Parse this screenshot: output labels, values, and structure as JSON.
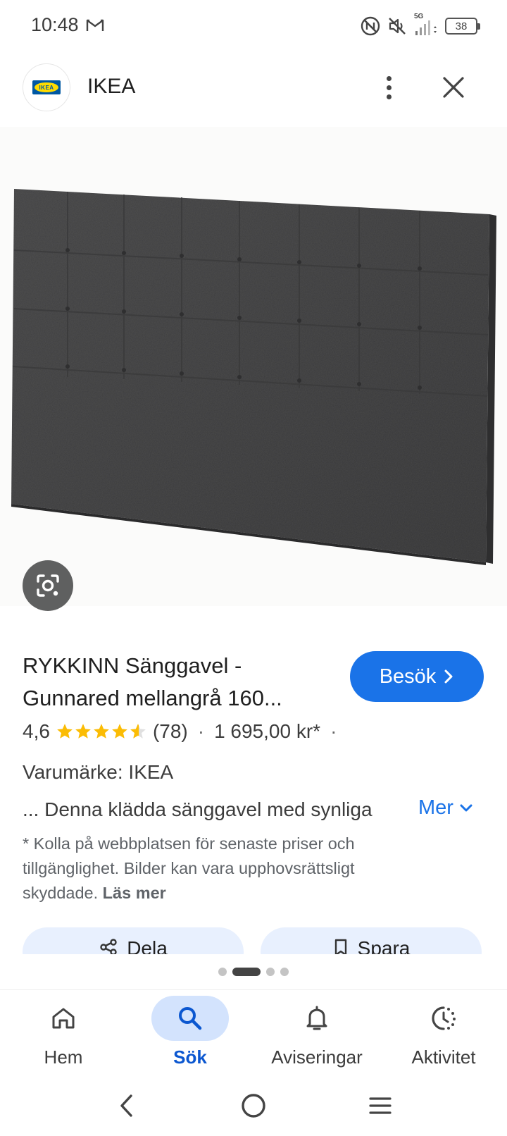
{
  "status_bar": {
    "time": "10:48",
    "network": "5G",
    "battery": "38",
    "icons": [
      "gmail-icon",
      "nfc-icon",
      "mute-icon",
      "signal-icon",
      "battery-icon"
    ]
  },
  "header": {
    "logo_text": "IKEA",
    "title": "IKEA"
  },
  "product": {
    "title": "RYKKINN Sänggavel - Gunnared mellangrå 160...",
    "visit_label": "Besök",
    "rating": "4,6",
    "rating_value": 4.6,
    "reviews": "(78)",
    "price": "1 695,00 kr*",
    "brand": "Varumärke: IKEA",
    "description": "... Denna klädda sänggavel med synliga",
    "more_label": "Mer",
    "disclaimer": "* Kolla på webbplatsen för senaste priser och tillgänglighet. Bilder kan vara upphovsrättsligt skyddade.",
    "read_more": "Läs mer"
  },
  "actions": {
    "share_label": "Dela",
    "save_label": "Spara"
  },
  "pager": {
    "count": 4,
    "active_index": 1
  },
  "bottom_nav": {
    "items": [
      {
        "label": "Hem",
        "icon": "home-icon"
      },
      {
        "label": "Sök",
        "icon": "search-icon",
        "active": true
      },
      {
        "label": "Aviseringar",
        "icon": "bell-icon"
      },
      {
        "label": "Aktivitet",
        "icon": "activity-icon"
      }
    ]
  },
  "colors": {
    "accent": "#1a73e8",
    "active_nav_bg": "#d3e3fd",
    "star": "#fbbc04",
    "headboard": "#4a4a4b"
  }
}
